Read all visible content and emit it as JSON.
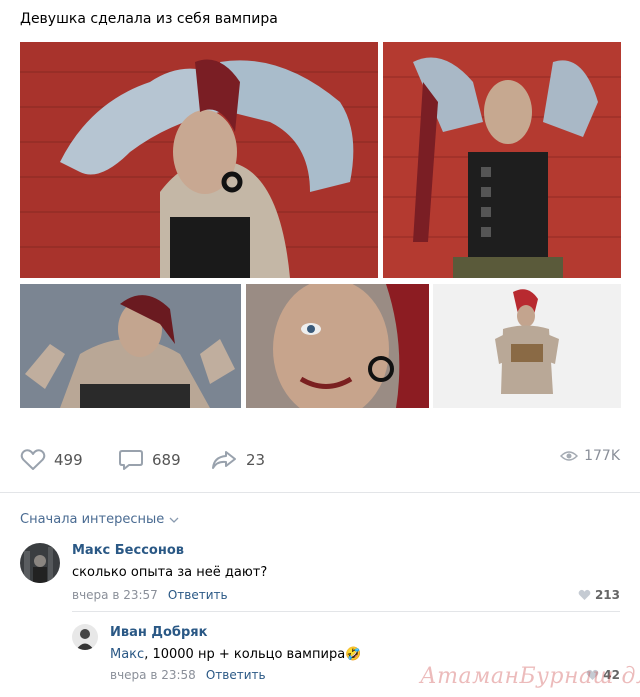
{
  "post": {
    "title": "Девушка сделала из себя вампира"
  },
  "photos": [
    {
      "name": "photo-1",
      "background": "#a8332c"
    },
    {
      "name": "photo-2",
      "background": "#b43a30"
    },
    {
      "name": "photo-3",
      "background": "#7b8592"
    },
    {
      "name": "photo-4",
      "background": "#9a8c84"
    },
    {
      "name": "photo-5",
      "background": "#f1f1f1"
    }
  ],
  "actions": {
    "likes": "499",
    "comments": "689",
    "shares": "23",
    "views": "177K",
    "like_icon": "heart-icon",
    "comment_icon": "speech-bubble-icon",
    "share_icon": "share-arrow-icon",
    "views_icon": "eye-icon"
  },
  "comments_sort": {
    "label": "Сначала интересные",
    "icon": "chevron-down-icon"
  },
  "comments": [
    {
      "author": "Макс Бессонов",
      "text": "сколько опыта за неё дают?",
      "time": "вчера в 23:57",
      "reply_label": "Ответить",
      "likes": "213"
    },
    {
      "author": "Иван Добряк",
      "mention": "Макс",
      "text": ", 10000 нр + кольцо вампира",
      "emoji": "🤣",
      "time": "вчера в 23:58",
      "reply_label": "Ответить",
      "likes": "42"
    }
  ],
  "watermark": "АтаманБурнаш для ПП",
  "colors": {
    "link": "#2a5885",
    "meta": "#8a8f99",
    "action": "#8a8f99"
  }
}
